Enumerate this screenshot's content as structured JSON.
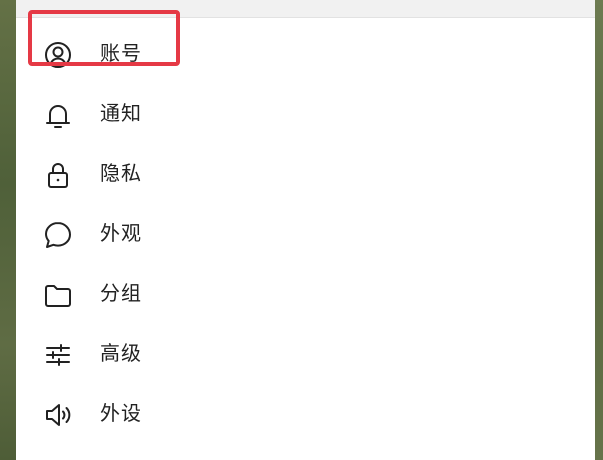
{
  "menu": {
    "items": [
      {
        "label": "账号",
        "icon": "account-circle-icon"
      },
      {
        "label": "通知",
        "icon": "bell-icon"
      },
      {
        "label": "隐私",
        "icon": "lock-icon"
      },
      {
        "label": "外观",
        "icon": "chat-bubble-icon"
      },
      {
        "label": "分组",
        "icon": "folder-icon"
      },
      {
        "label": "高级",
        "icon": "sliders-icon"
      },
      {
        "label": "外设",
        "icon": "speaker-icon"
      }
    ],
    "highlighted_item": "账号",
    "highlight_color": "#e53945"
  }
}
